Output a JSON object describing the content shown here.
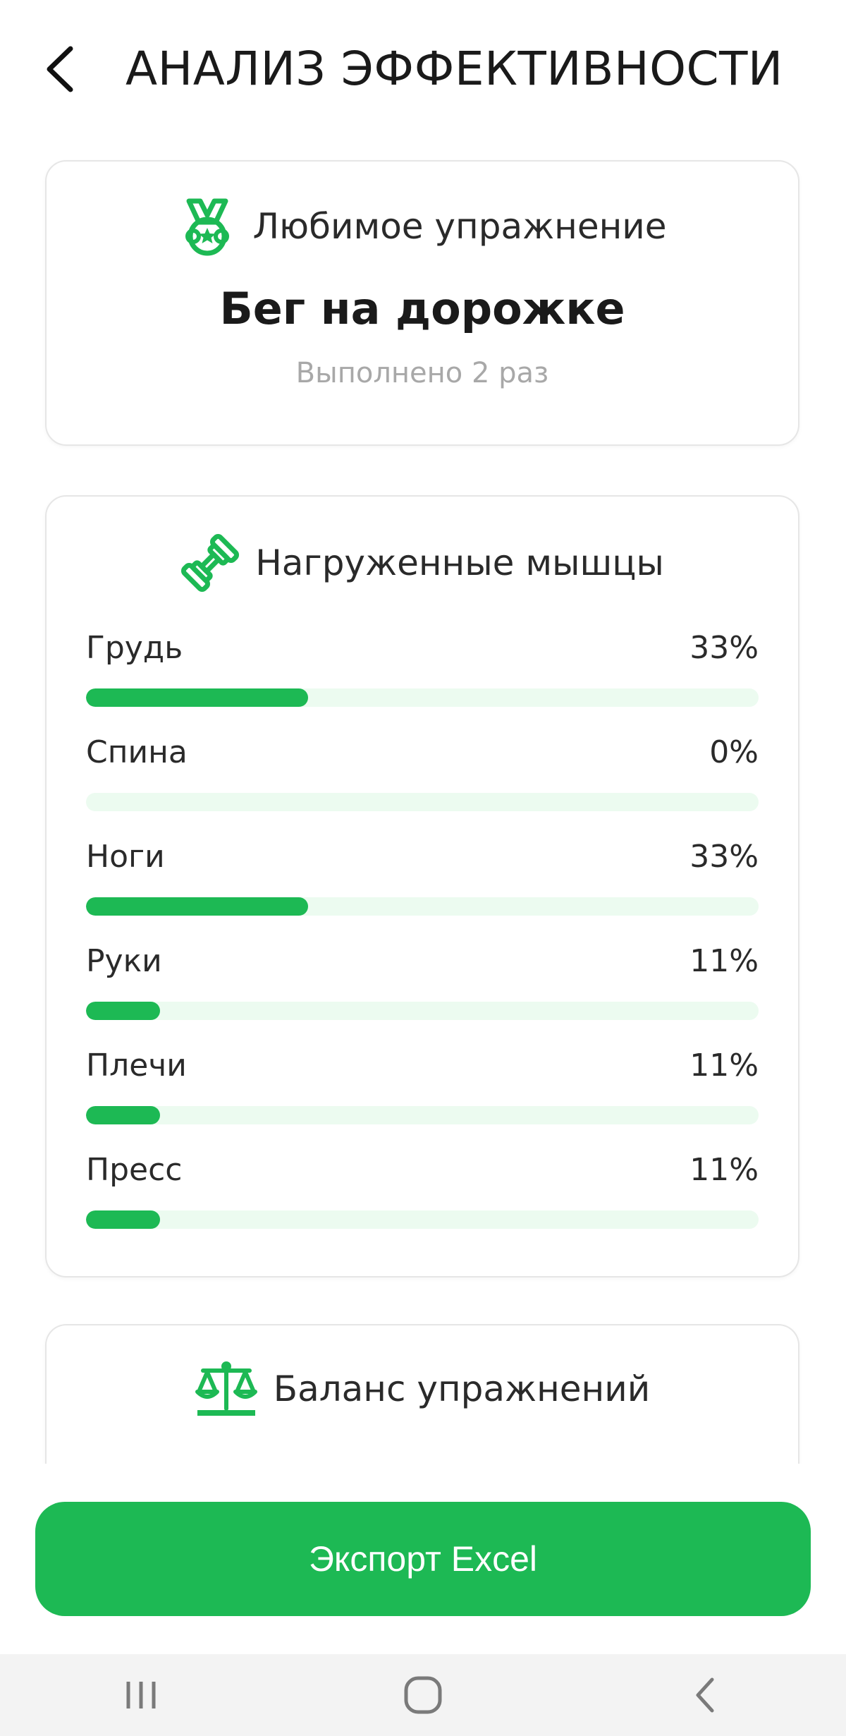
{
  "header": {
    "title": "АНАЛИЗ ЭФФЕКТИВНОСТИ",
    "back_icon": "chevron-left-icon"
  },
  "favorite": {
    "icon": "medal-icon",
    "heading": "Любимое упражнение",
    "exercise": "Бег на дорожке",
    "count_text": "Выполнено 2 раз"
  },
  "muscles": {
    "icon": "dumbbell-icon",
    "heading": "Нагруженные мышцы",
    "items": [
      {
        "label": "Грудь",
        "value_text": "33%",
        "fraction": 0.33
      },
      {
        "label": "Спина",
        "value_text": "0%",
        "fraction": 0
      },
      {
        "label": "Ноги",
        "value_text": "33%",
        "fraction": 0.33
      },
      {
        "label": "Руки",
        "value_text": "11%",
        "fraction": 0.11
      },
      {
        "label": "Плечи",
        "value_text": "11%",
        "fraction": 0.11
      },
      {
        "label": "Пресс",
        "value_text": "11%",
        "fraction": 0.11
      }
    ]
  },
  "balance": {
    "icon": "scales-icon",
    "heading": "Баланс упражнений"
  },
  "export": {
    "label": "Экспорт Excel"
  },
  "system_nav": {
    "recents_icon": "recents-icon",
    "home_icon": "home-icon",
    "back_icon": "back-chevron-icon"
  },
  "colors": {
    "accent": "#1db954",
    "track": "#ecfbf0",
    "muted_text": "#a8a8a8"
  }
}
